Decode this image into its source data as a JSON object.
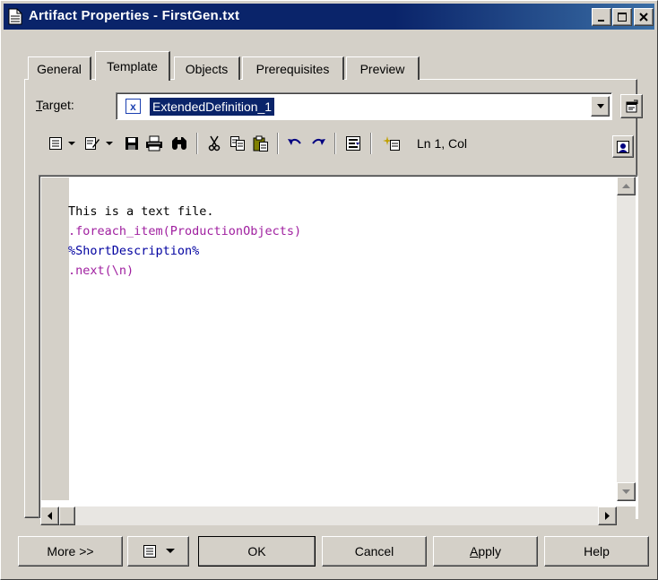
{
  "window": {
    "title": "Artifact Properties - FirstGen.txt",
    "controls": {
      "minimize": "_",
      "maximize": "□",
      "close": "✕"
    }
  },
  "tabs": [
    {
      "label": "General",
      "active": false
    },
    {
      "label": "Template",
      "active": true
    },
    {
      "label": "Objects",
      "active": false
    },
    {
      "label": "Prerequisites",
      "active": false
    },
    {
      "label": "Preview",
      "active": false
    }
  ],
  "target": {
    "label_prefix": "",
    "label_accel": "T",
    "label_rest": "arget:",
    "selected_value": "ExtendedDefinition_1",
    "item_icon": "x-icon"
  },
  "toolbar": {
    "cursor_position": "Ln 1, Col"
  },
  "editor": {
    "lines": [
      {
        "text": "This is a text file.",
        "color": "#000000"
      },
      {
        "text": ".foreach_item(ProductionObjects)",
        "color": "#a020a0"
      },
      {
        "text": "%ShortDescription%",
        "color": "#0000a0"
      },
      {
        "text": ".next(\\n)",
        "color": "#a020a0"
      }
    ]
  },
  "buttons": {
    "more": "More >>",
    "ok": "OK",
    "cancel": "Cancel",
    "apply_accel": "A",
    "apply_rest": "pply",
    "help": "Help"
  }
}
